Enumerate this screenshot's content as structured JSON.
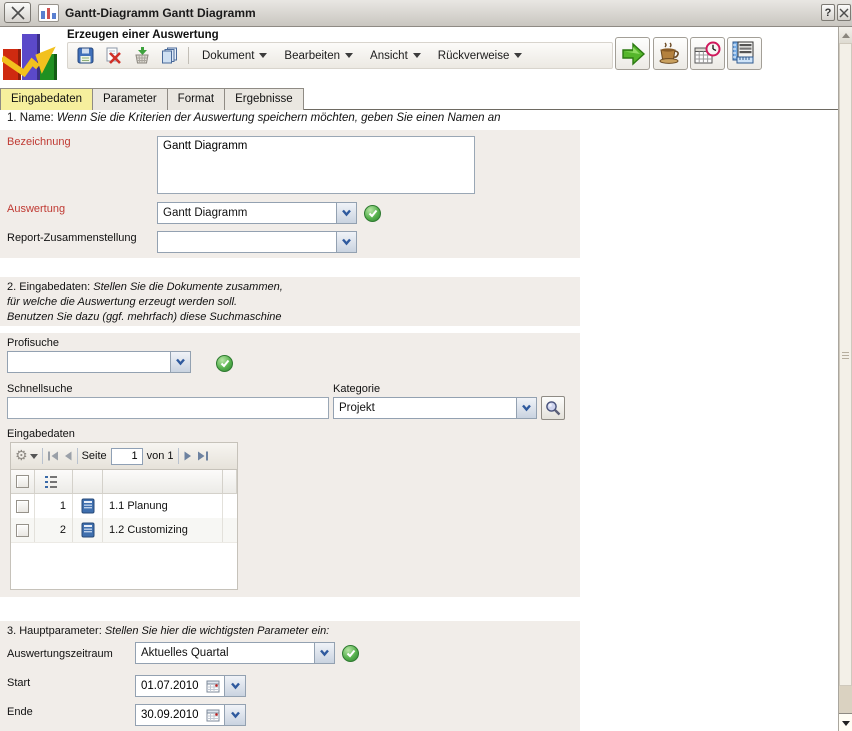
{
  "window": {
    "title": "Gantt-Diagramm Gantt Diagramm",
    "help_label": "?"
  },
  "header": {
    "app_title": "Erzeugen einer Auswertung",
    "menus": [
      "Dokument",
      "Bearbeiten",
      "Ansicht",
      "Rückverweise"
    ]
  },
  "tabs": [
    {
      "label": "Eingabedaten",
      "active": true
    },
    {
      "label": "Parameter",
      "active": false
    },
    {
      "label": "Format",
      "active": false
    },
    {
      "label": "Ergebnisse",
      "active": false
    }
  ],
  "section1": {
    "heading": "1. Name:",
    "heading_hint": "Wenn Sie die Kriterien der Auswertung speichern möchten, geben Sie einen Namen an",
    "bezeichnung_label": "Bezeichnung",
    "bezeichnung_value": "Gantt Diagramm",
    "auswertung_label": "Auswertung",
    "auswertung_value": "Gantt Diagramm",
    "report_label": "Report-Zusammenstellung",
    "report_value": ""
  },
  "section2": {
    "heading": "2. Eingabedaten:",
    "hint_line1": "Stellen Sie die Dokumente zusammen,",
    "hint_line2": "für welche die Auswertung erzeugt werden soll.",
    "hint_line3": "Benutzen Sie dazu (ggf. mehrfach) diese Suchmaschine",
    "profisuche_label": "Profisuche",
    "profisuche_value": "",
    "schnellsuche_label": "Schnellsuche",
    "schnellsuche_value": "",
    "kategorie_label": "Kategorie",
    "kategorie_value": "Projekt",
    "grid_label": "Eingabedaten",
    "pager": {
      "seite_label": "Seite",
      "page_value": "1",
      "of_label": "von 1"
    },
    "rows": [
      {
        "num": "1",
        "name": "1.1 Planung"
      },
      {
        "num": "2",
        "name": "1.2 Customizing"
      }
    ]
  },
  "section3": {
    "heading": "3. Hauptparameter:",
    "heading_hint": "Stellen Sie hier die wichtigsten Parameter ein:",
    "zeitraum_label": "Auswertungszeitraum",
    "zeitraum_value": "Aktuelles Quartal",
    "start_label": "Start",
    "start_value": "01.07.2010",
    "ende_label": "Ende",
    "ende_value": "30.09.2010"
  },
  "colors": {
    "accent_red_label": "#c03a33",
    "tab_active_bg": "#f6ef9d",
    "panel_bg": "#f1ede9",
    "check_green": "#4caf50"
  }
}
